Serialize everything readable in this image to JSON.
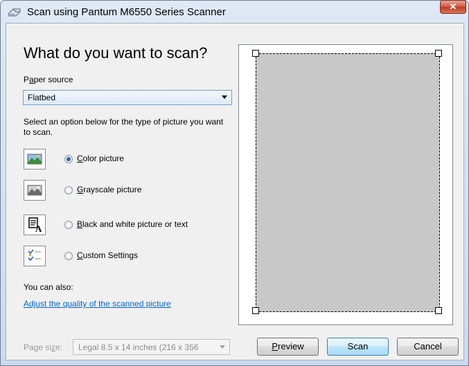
{
  "window": {
    "title": "Scan using Pantum M6550 Series Scanner",
    "close_glyph": "✕"
  },
  "heading": "What do you want to scan?",
  "paper_source": {
    "label_pre": "P",
    "label_mnemonic": "a",
    "label_post": "per source",
    "value": "Flatbed"
  },
  "instructions": "Select an option below for the type of picture you want to scan.",
  "options": [
    {
      "mnemonic": "C",
      "rest": "olor picture",
      "checked": true,
      "icon": "color-picture-icon"
    },
    {
      "mnemonic": "G",
      "rest": "rayscale picture",
      "checked": false,
      "icon": "grayscale-picture-icon"
    },
    {
      "mnemonic": "B",
      "rest": "lack and white picture or text",
      "checked": false,
      "icon": "black-white-text-icon"
    },
    {
      "mnemonic": "C",
      "rest": "ustom Settings",
      "checked": false,
      "icon": "custom-settings-icon"
    }
  ],
  "also_label": "You can also:",
  "adjust_link": "Adjust the quality of the scanned picture",
  "page_size": {
    "label_pre": "Page si",
    "label_mnemonic": "z",
    "label_post": "e:",
    "value": "Legal 8.5 x 14 inches (216 x 356"
  },
  "buttons": {
    "preview": {
      "mnemonic": "P",
      "rest": "review"
    },
    "scan": "Scan",
    "cancel": "Cancel"
  }
}
